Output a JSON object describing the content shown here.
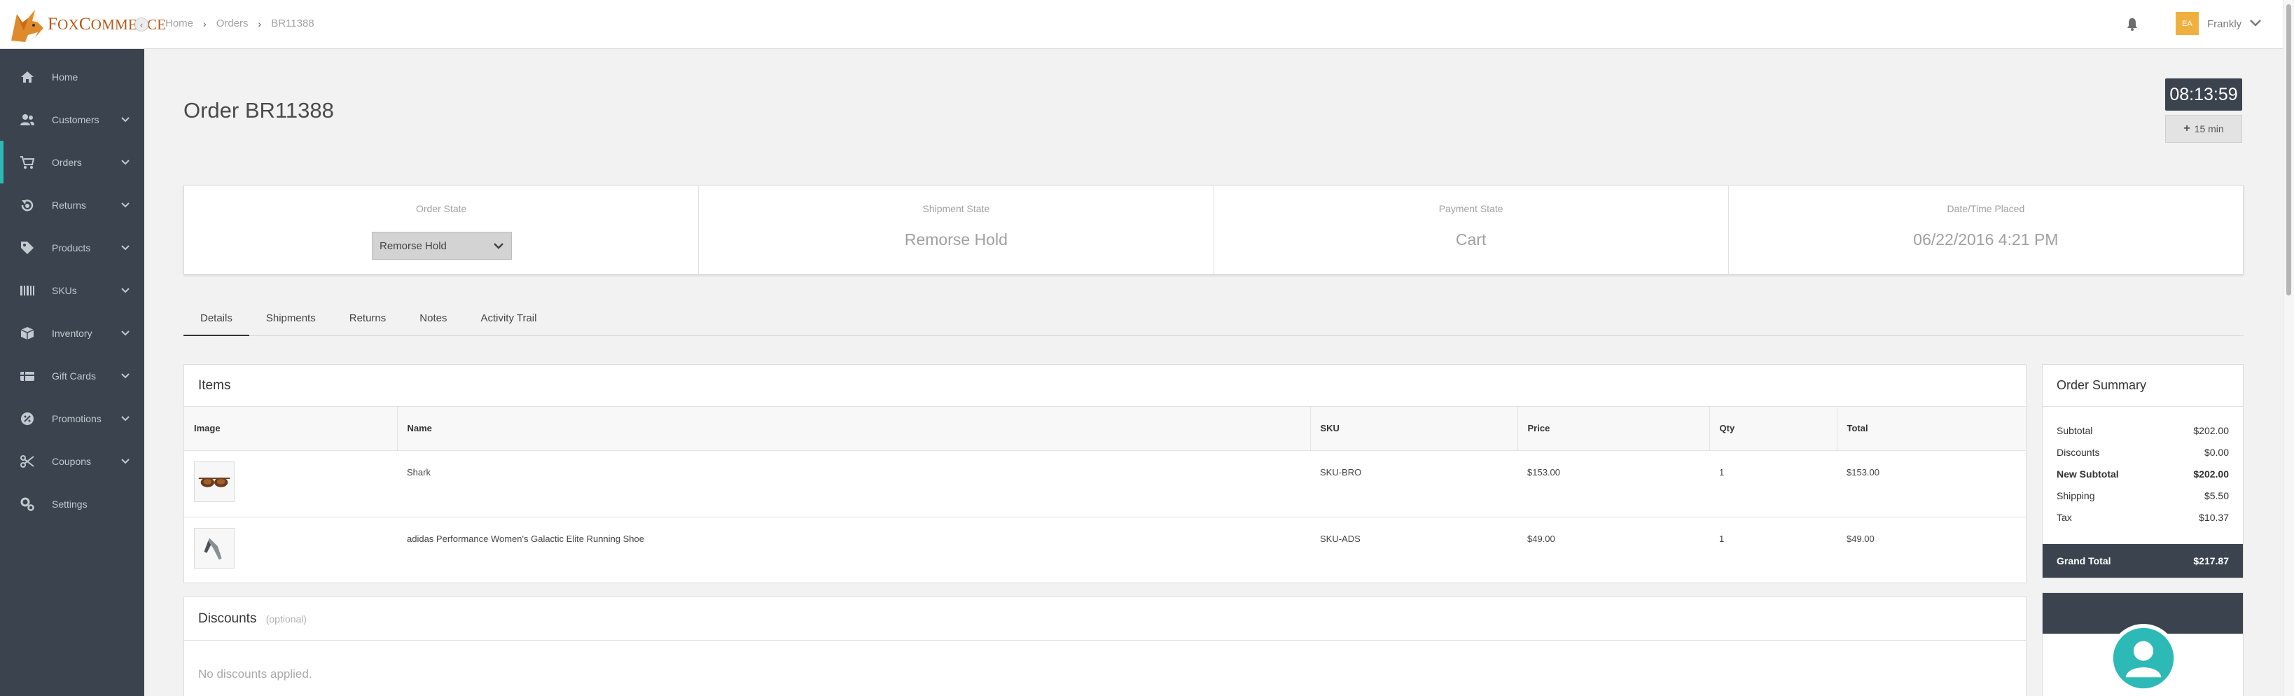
{
  "logo": {
    "prefix_cap": "F",
    "prefix": "OX",
    "suffix_cap": "C",
    "suffix": "OMMERCE"
  },
  "breadcrumb": [
    "Home",
    "Orders",
    "BR11388"
  ],
  "user": {
    "initials": "EA",
    "name": "Frankly"
  },
  "sidebar": {
    "items": [
      {
        "label": "Home",
        "icon": "home-icon"
      },
      {
        "label": "Customers",
        "icon": "users-icon"
      },
      {
        "label": "Orders",
        "icon": "cart-icon"
      },
      {
        "label": "Returns",
        "icon": "returns-icon"
      },
      {
        "label": "Products",
        "icon": "tag-icon"
      },
      {
        "label": "SKUs",
        "icon": "barcode-icon"
      },
      {
        "label": "Inventory",
        "icon": "box-icon"
      },
      {
        "label": "Gift Cards",
        "icon": "gift-card-icon"
      },
      {
        "label": "Promotions",
        "icon": "promo-icon"
      },
      {
        "label": "Coupons",
        "icon": "scissors-icon"
      },
      {
        "label": "Settings",
        "icon": "gears-icon"
      }
    ],
    "active_index": 2
  },
  "page": {
    "title": "Order BR11388"
  },
  "timer": {
    "value": "08:13:59",
    "add_label": "15 min"
  },
  "states": {
    "order_label": "Order State",
    "order_value": "Remorse Hold",
    "shipment_label": "Shipment State",
    "shipment_value": "Remorse Hold",
    "payment_label": "Payment State",
    "payment_value": "Cart",
    "date_label": "Date/Time Placed",
    "date_value": "06/22/2016 4:21 PM"
  },
  "tabs": [
    "Details",
    "Shipments",
    "Returns",
    "Notes",
    "Activity Trail"
  ],
  "items": {
    "title": "Items",
    "columns": [
      "Image",
      "Name",
      "SKU",
      "Price",
      "Qty",
      "Total"
    ],
    "rows": [
      {
        "name": "Shark",
        "sku": "SKU-BRO",
        "price": "$153.00",
        "qty": "1",
        "total": "$153.00"
      },
      {
        "name": "adidas Performance Women's Galactic Elite Running Shoe",
        "sku": "SKU-ADS",
        "price": "$49.00",
        "qty": "1",
        "total": "$49.00"
      }
    ]
  },
  "discounts": {
    "title": "Discounts",
    "optional": "(optional)",
    "empty": "No discounts applied."
  },
  "summary": {
    "title": "Order Summary",
    "subtotal_label": "Subtotal",
    "subtotal": "$202.00",
    "discounts_label": "Discounts",
    "discounts": "$0.00",
    "new_subtotal_label": "New Subtotal",
    "new_subtotal": "$202.00",
    "shipping_label": "Shipping",
    "shipping": "$5.50",
    "tax_label": "Tax",
    "tax": "$10.37",
    "grand_total_label": "Grand Total",
    "grand_total": "$217.87"
  },
  "colors": {
    "sidebar": "#3a434e",
    "accent": "#2dbab7",
    "brand": "#b65b1a"
  }
}
